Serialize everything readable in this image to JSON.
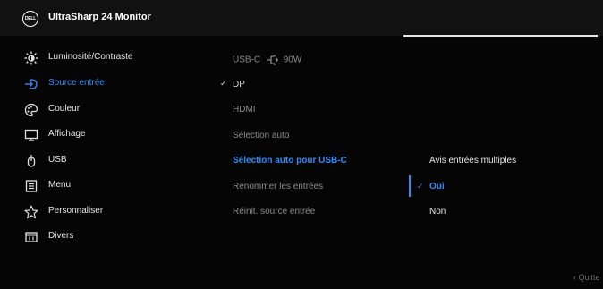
{
  "header": {
    "logo_text": "DELL",
    "title": "UltraSharp 24 Monitor"
  },
  "menu": [
    {
      "label": "Luminosité/Contraste",
      "icon": "brightness-icon",
      "active": false
    },
    {
      "label": "Source entrée",
      "icon": "input-source-icon",
      "active": true
    },
    {
      "label": "Couleur",
      "icon": "color-palette-icon",
      "active": false
    },
    {
      "label": "Affichage",
      "icon": "display-icon",
      "active": false
    },
    {
      "label": "USB",
      "icon": "usb-icon",
      "active": false
    },
    {
      "label": "Menu",
      "icon": "menu-list-icon",
      "active": false
    },
    {
      "label": "Personnaliser",
      "icon": "star-icon",
      "active": false
    },
    {
      "label": "Divers",
      "icon": "others-icon",
      "active": false
    }
  ],
  "submenu": {
    "usbc": {
      "label": "USB-C",
      "power": "90W"
    },
    "dp": "DP",
    "hdmi": "HDMI",
    "auto": "Sélection auto",
    "auto_usbc": "Sélection auto pour USB-C",
    "rename": "Renommer les entrées",
    "reset": "Réinit. source entrée"
  },
  "options": {
    "multi": "Avis entrées multiples",
    "oui": "Oui",
    "non": "Non"
  },
  "footer": {
    "exit": "Quitte"
  },
  "colors": {
    "accent": "#2f8cf5",
    "background": "#050505"
  }
}
